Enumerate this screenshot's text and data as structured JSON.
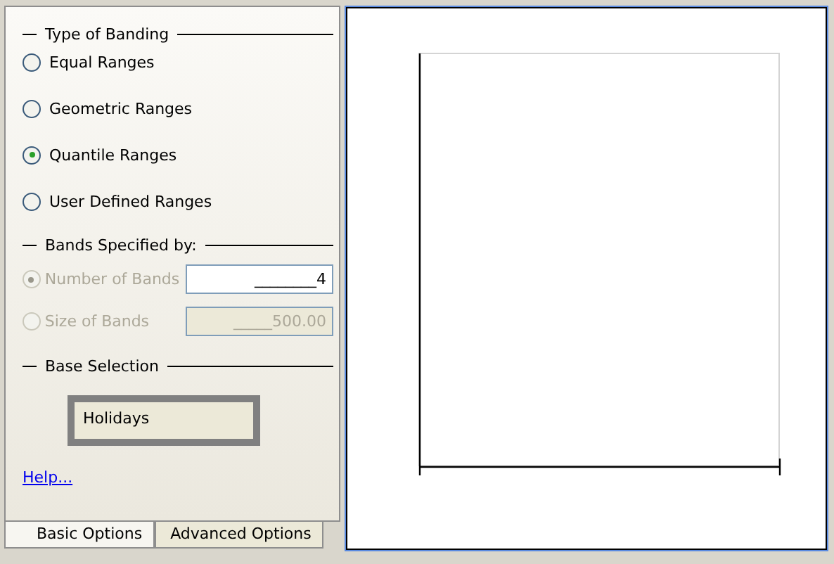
{
  "type_of_banding": {
    "title": "Type of Banding",
    "options": [
      {
        "label": "Equal Ranges",
        "selected": false
      },
      {
        "label": "Geometric Ranges",
        "selected": false
      },
      {
        "label": "Quantile Ranges",
        "selected": true
      },
      {
        "label": "User Defined Ranges",
        "selected": false
      }
    ]
  },
  "bands_specified_by": {
    "title": "Bands Specified by:",
    "options": [
      {
        "label": "Number of Bands",
        "selected": true,
        "disabled": true,
        "value": "________4",
        "field_disabled": false
      },
      {
        "label": "Size of Bands",
        "selected": false,
        "disabled": true,
        "value": "_____500.00",
        "field_disabled": true
      }
    ]
  },
  "base_selection": {
    "title": "Base Selection",
    "value": "Holidays"
  },
  "help_link": "Help...",
  "tabs": [
    {
      "label": "Basic Options",
      "selected": true
    },
    {
      "label": "Advanced Options",
      "selected": false
    }
  ]
}
